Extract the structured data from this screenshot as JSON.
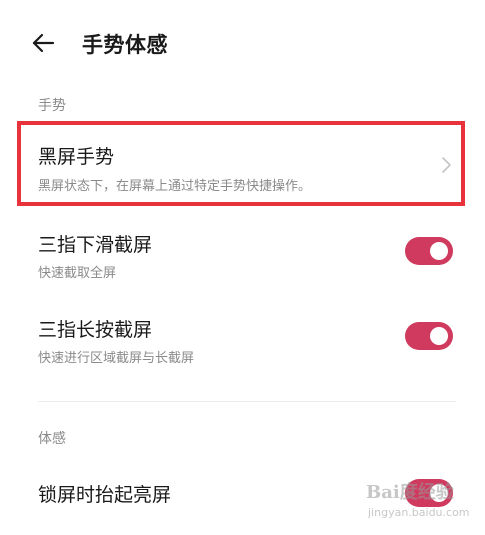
{
  "header": {
    "title": "手势体感",
    "back_icon": "arrow-left-icon"
  },
  "sections": {
    "gesture_label": "手势",
    "feel_label": "体感"
  },
  "items": {
    "black_screen": {
      "title": "黑屏手势",
      "desc": "黑屏状态下，在屏幕上通过特定手势快捷操作。",
      "trailing_icon": "chevron-right-icon"
    },
    "three_finger_down": {
      "title": "三指下滑截屏",
      "desc": "快速截取全屏",
      "toggle_on": true
    },
    "three_finger_hold": {
      "title": "三指长按截屏",
      "desc": "快速进行区域截屏与长截屏",
      "toggle_on": true
    },
    "raise_to_wake": {
      "title": "锁屏时抬起亮屏",
      "toggle_on": true
    }
  },
  "watermark": {
    "logo": "Bai度经验",
    "url": "jingyan.baidu.com"
  },
  "colors": {
    "accent": "#cf3a5e",
    "highlight_border": "#e8333c",
    "secondary_text": "#8a8a8a"
  }
}
